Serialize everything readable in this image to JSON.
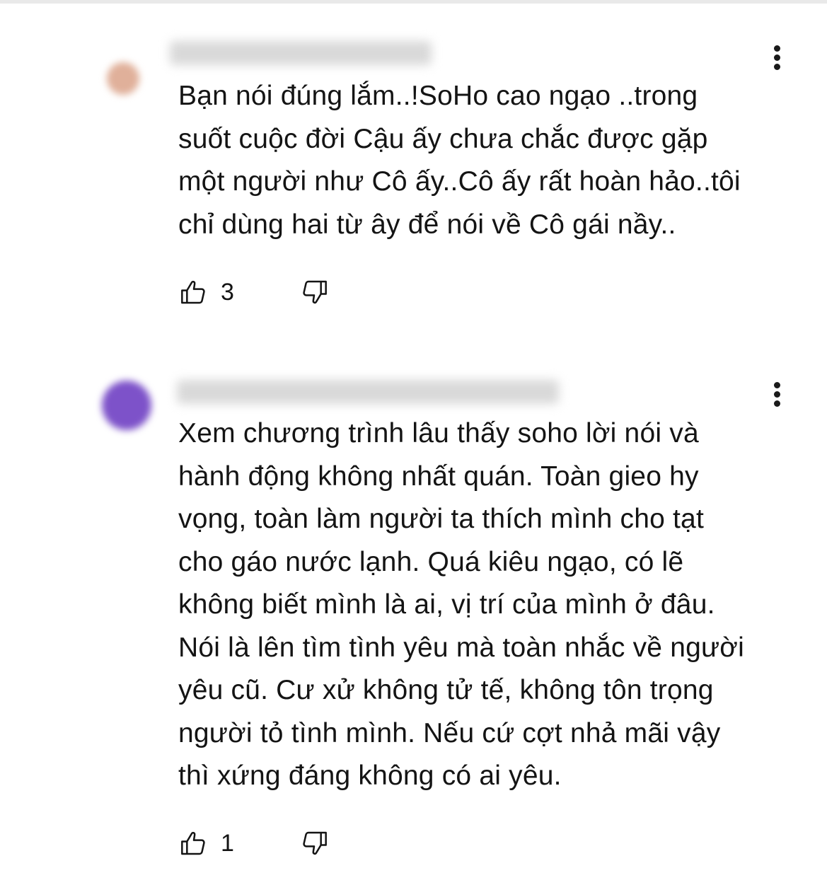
{
  "colors": {
    "text": "#141414",
    "avatar_1": "#d9a189",
    "avatar_2": "#7d52c9",
    "redacted": "#d9d9d9"
  },
  "comments": [
    {
      "author_meta": "",
      "text": "Bạn nói đúng lắm..!SoHo cao ngạo ..trong\nsuốt cuộc đời Cậu ấy chưa chắc được gặp\nmột người như Cô ấy..Cô ấy rất hoàn hảo..tôi\nchỉ dùng hai từ ây để nói về Cô gái nầy..",
      "like_count": "3",
      "icons": {
        "like": "thumbs-up-icon",
        "dislike": "thumbs-down-icon",
        "more": "more-vertical-icon"
      }
    },
    {
      "author_meta": "",
      "text": "Xem chương trình lâu thấy soho lời nói và\nhành động không nhất quán. Toàn gieo hy\nvọng, toàn làm người ta thích mình cho tạt\ncho gáo nước lạnh. Quá kiêu ngạo, có lẽ\nkhông biết mình là ai, vị trí của mình ở đâu.\nNói là lên tìm tình yêu mà toàn nhắc về người\nyêu cũ. Cư xử không tử tế, không tôn trọng\nngười tỏ tình mình. Nếu cứ cợt nhả mãi vậy\nthì xứng đáng không có ai yêu.",
      "like_count": "1",
      "icons": {
        "like": "thumbs-up-icon",
        "dislike": "thumbs-down-icon",
        "more": "more-vertical-icon"
      }
    }
  ]
}
